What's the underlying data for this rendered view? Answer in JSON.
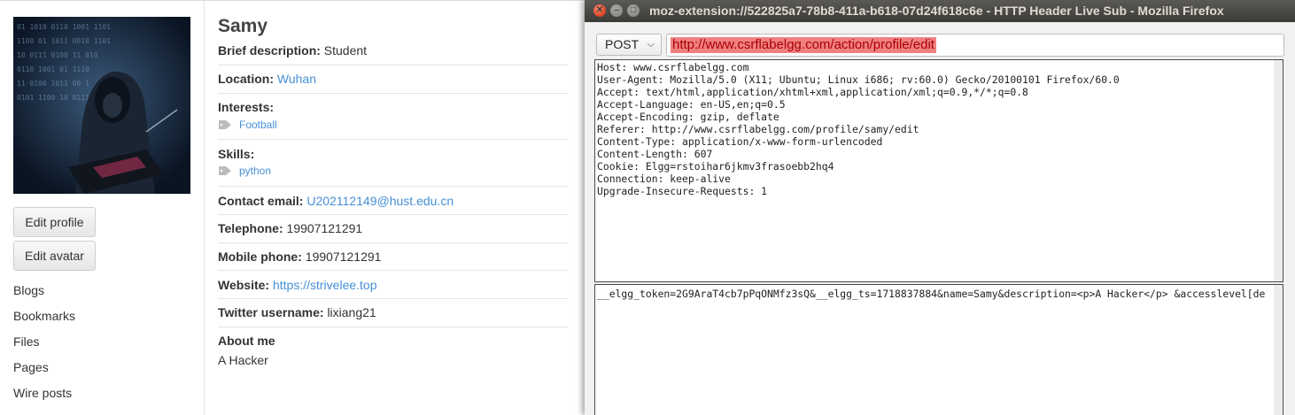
{
  "profile": {
    "name": "Samy",
    "brief_description_label": "Brief description:",
    "brief_description": "Student",
    "location_label": "Location:",
    "location": "Wuhan",
    "interests_label": "Interests:",
    "interests_tag": "Football",
    "skills_label": "Skills:",
    "skills_tag": "python",
    "contact_email_label": "Contact email:",
    "contact_email": "U202112149@hust.edu.cn",
    "telephone_label": "Telephone:",
    "telephone": "19907121291",
    "mobile_label": "Mobile phone:",
    "mobile": "19907121291",
    "website_label": "Website:",
    "website": "https://strivelee.top",
    "twitter_label": "Twitter username:",
    "twitter": "lixiang21",
    "about_label": "About me",
    "about": "A Hacker"
  },
  "owner_buttons": {
    "edit_profile": "Edit profile",
    "edit_avatar": "Edit avatar"
  },
  "owner_menu": [
    "Blogs",
    "Bookmarks",
    "Files",
    "Pages",
    "Wire posts"
  ],
  "window": {
    "title": "moz-extension://522825a7-78b8-411a-b618-07d24f618c6e - HTTP Header Live Sub - Mozilla Firefox"
  },
  "request": {
    "method": "POST",
    "url": "http://www.csrflabelgg.com/action/profile/edit",
    "headers": [
      "Host: www.csrflabelgg.com",
      "User-Agent: Mozilla/5.0 (X11; Ubuntu; Linux i686; rv:60.0) Gecko/20100101 Firefox/60.0",
      "Accept: text/html,application/xhtml+xml,application/xml;q=0.9,*/*;q=0.8",
      "Accept-Language: en-US,en;q=0.5",
      "Accept-Encoding: gzip, deflate",
      "Referer: http://www.csrflabelgg.com/profile/samy/edit",
      "Content-Type: application/x-www-form-urlencoded",
      "Content-Length: 607",
      "Cookie: Elgg=rstoihar6jkmv3frasoebb2hq4",
      "Connection: keep-alive",
      "Upgrade-Insecure-Requests: 1"
    ],
    "body": "__elgg_token=2G9AraT4cb7pPqONMfz3sQ&__elgg_ts=1718837884&name=Samy&description=<p>A Hacker</p> &accesslevel[de"
  },
  "colors": {
    "link": "#4690d6",
    "url_highlight": "#f08080",
    "titlebar": "#3c3b37",
    "close_button": "#e0492d"
  }
}
